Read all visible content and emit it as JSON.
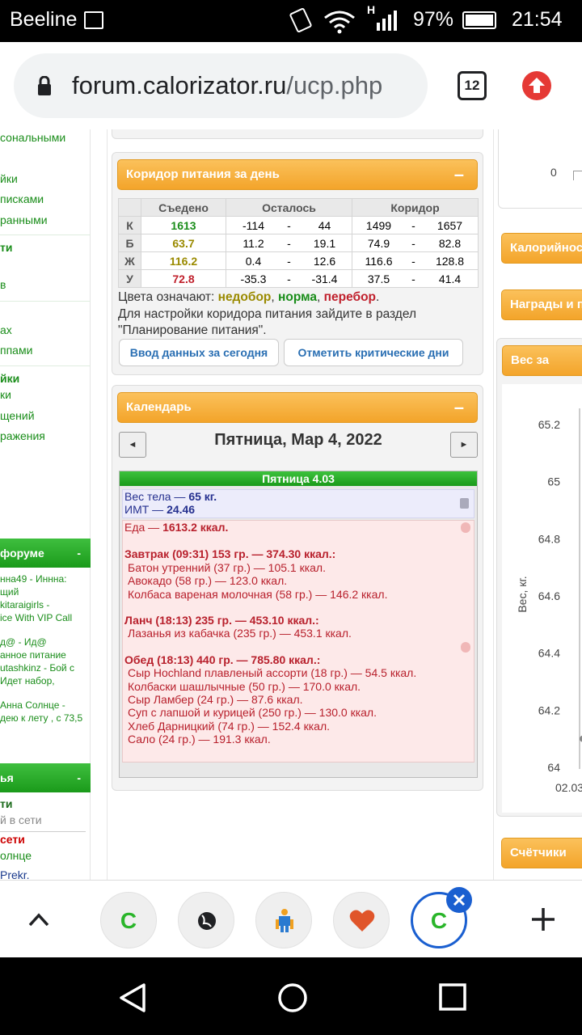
{
  "status": {
    "carrier": "Beeline",
    "battery": "97%",
    "time": "21:54",
    "network": "H"
  },
  "browser": {
    "url_host": "forum.calorizator.ru",
    "url_path": "/ucp.php",
    "tab_count": "12"
  },
  "sidebar": {
    "items_top": [
      "сональными",
      "йки",
      "писками",
      "ранными"
    ],
    "group1_title": "ти",
    "group1_item": "в",
    "group2_items": [
      "ах",
      "ппами"
    ],
    "group3_title": "йки",
    "group3_items": [
      "ки",
      "щений",
      "ражения"
    ],
    "forum_header": "форуме",
    "forum_lines": [
      "нна49 - Инннa:",
      "щий",
      "kitaraigirls -",
      "ice With VIP Call",
      "д@ - Ид@",
      "анное питание",
      "utashkinz - Бой с",
      "Идет набор,",
      "Анна Солнце -",
      "дею к лету , с 73,5"
    ],
    "online_header": "ья",
    "online_title": "ти",
    "online_sub": "й в сети",
    "online_red": "сети",
    "online_user": "олнце",
    "online_user2": "Prekr."
  },
  "corridor": {
    "title": "Коридор питания за день",
    "headers": [
      "Съедено",
      "Осталось",
      "Коридор"
    ],
    "rows": [
      {
        "label": "К",
        "eaten": "1613",
        "rem_from": "-114",
        "rem_to": "44",
        "cor_from": "1499",
        "cor_to": "1657",
        "color": "#1a8d1a"
      },
      {
        "label": "Б",
        "eaten": "63.7",
        "rem_from": "11.2",
        "rem_to": "19.1",
        "cor_from": "74.9",
        "cor_to": "82.8",
        "color": "#9a8a00"
      },
      {
        "label": "Ж",
        "eaten": "116.2",
        "rem_from": "0.4",
        "rem_to": "12.6",
        "cor_from": "116.6",
        "cor_to": "128.8",
        "color": "#9a8a00"
      },
      {
        "label": "У",
        "eaten": "72.8",
        "rem_from": "-35.3",
        "rem_to": "-31.4",
        "cor_from": "37.5",
        "cor_to": "41.4",
        "color": "#c0202c"
      }
    ],
    "dash": "-",
    "legend_prefix": "Цвета означают:",
    "legend_low": "недобор",
    "legend_norm": "норма",
    "legend_high": "перебор",
    "note_line1": "Для настройки коридора питания зайдите в раздел",
    "note_line2": "\"Планирование питания\".",
    "btn_today": "Ввод данных за сегодня",
    "btn_critical": "Отметить критические дни"
  },
  "calendar": {
    "title": "Календарь",
    "date_title": "Пятница, Мар 4, 2022",
    "prev": "◄",
    "next": "►",
    "day_header": "Пятница 4.03",
    "weight_label": "Вес тела —",
    "weight_value": "65 кг.",
    "bmi_label": "ИМТ —",
    "bmi_value": "24.46",
    "food_label": "Еда —",
    "food_value": "1613.2 ккал.",
    "meals": [
      {
        "title": "Завтрак (09:31) 153 гр. — 374.30 ккал.:",
        "items": [
          "Батон утренний (37 гр.) — 105.1 ккал.",
          "Авокадо (58 гр.) — 123.0 ккал.",
          "Колбаса вареная молочная (58 гр.) — 146.2 ккал."
        ]
      },
      {
        "title": "Ланч (18:13) 235 гр. — 453.10 ккал.:",
        "items": [
          "Лазанья из кабачка (235 гр.) — 453.1 ккал."
        ]
      },
      {
        "title": "Обед (18:13) 440 гр. — 785.80 ккал.:",
        "items": [
          "Сыр Hochland плавленый ассорти (18 гр.) — 54.5 ккал.",
          "Колбаски шашлычные (50 гр.) — 170.0 ккал.",
          "Сыр Ламбер (24 гр.) — 87.6 ккал.",
          "Суп с лапшой и курицей (250 гр.) — 130.0 ккал.",
          "Хлеб Дарницкий (74 гр.) — 152.4 ккал.",
          "Сало (24 гр.) — 191.3 ккал."
        ]
      }
    ]
  },
  "right_column": {
    "top_axis_value": "0",
    "calories_header": "Калорийност",
    "awards_header": "Награды и п",
    "weight_header": "Вес за недел",
    "counters_header": "Счётчики",
    "y_label": "Вес, кг.",
    "x_label": "02.03."
  },
  "chart_data": {
    "type": "line",
    "title": "Вес за недел",
    "ylabel": "Вес, кг.",
    "xlabel": "",
    "x": [
      "02.03."
    ],
    "y_ticks": [
      "65.2",
      "65",
      "64.8",
      "64.6",
      "64.4",
      "64.2",
      "64"
    ],
    "ylim": [
      64,
      65.2
    ],
    "series": [
      {
        "values": [
          64.1
        ]
      }
    ]
  },
  "tabs": {
    "letter": "C"
  }
}
